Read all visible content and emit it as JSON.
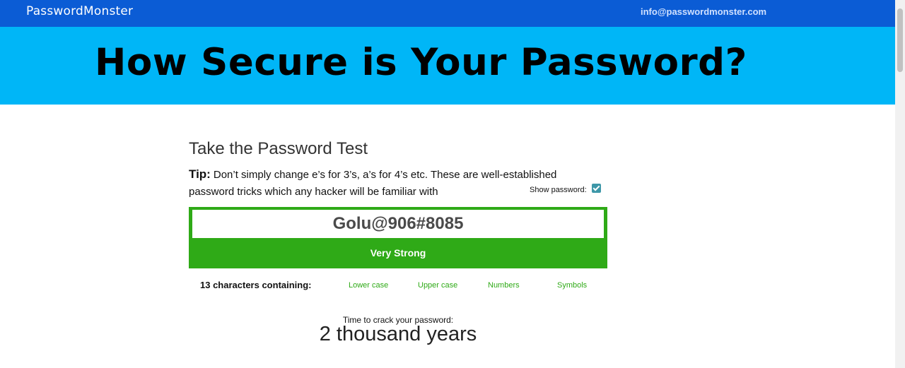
{
  "header": {
    "logo": "PasswordMonster",
    "email": "info@passwordmonster.com"
  },
  "hero": {
    "title": "How Secure is Your Password?"
  },
  "test": {
    "title": "Take the Password Test",
    "tip_label": "Tip:",
    "tip_text": "Don’t simply change e’s for 3’s, a’s for 4’s etc. These are well-established password tricks which any hacker will be familiar with",
    "show_password_label": "Show password:",
    "show_password_checked": true,
    "password_value": "Golu@906#8085",
    "strength": "Very Strong",
    "characters_summary": "13 characters containing:",
    "char_types": [
      "Lower case",
      "Upper case",
      "Numbers",
      "Symbols"
    ],
    "crack_label": "Time to crack your password:",
    "crack_time": "2 thousand years"
  },
  "colors": {
    "topbar": "#0b5cd5",
    "hero": "#00b6f7",
    "strength_green": "#2faa17",
    "checkbox": "#3d97a8"
  }
}
